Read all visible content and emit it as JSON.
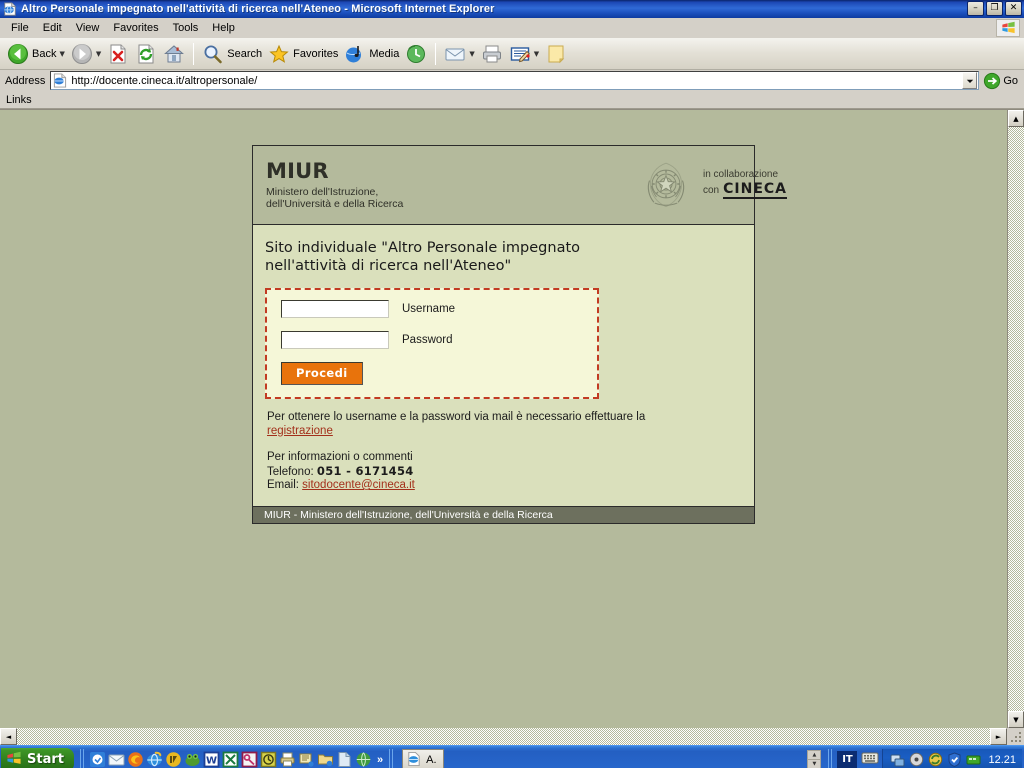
{
  "window": {
    "title": "Altro Personale impegnato nell'attività di ricerca nell'Ateneo - Microsoft Internet Explorer",
    "icon": "ie-document-icon",
    "minimize_label": "–",
    "restore_label": "❐",
    "close_label": "✕"
  },
  "menubar": {
    "items": [
      {
        "label": "File",
        "name": "menu-file"
      },
      {
        "label": "Edit",
        "name": "menu-edit"
      },
      {
        "label": "View",
        "name": "menu-view"
      },
      {
        "label": "Favorites",
        "name": "menu-favorites"
      },
      {
        "label": "Tools",
        "name": "menu-tools"
      },
      {
        "label": "Help",
        "name": "menu-help"
      }
    ],
    "brand_icon": "windows-flag-icon"
  },
  "toolbar": {
    "back_label": "Back",
    "forward_label": "",
    "stop_label": "",
    "refresh_label": "",
    "home_label": "",
    "search_label": "Search",
    "favorites_label": "Favorites",
    "media_label": "Media",
    "history_label": "",
    "mail_label": "",
    "print_label": "",
    "edit_label": "",
    "discuss_label": "",
    "icons": [
      "back-arrow-icon",
      "forward-arrow-icon",
      "stop-icon",
      "refresh-icon",
      "home-icon",
      "search-icon",
      "favorites-star-icon",
      "media-icon",
      "history-icon",
      "mail-icon",
      "print-icon",
      "edit-page-icon",
      "notes-icon"
    ]
  },
  "address_bar": {
    "label": "Address",
    "url": "http://docente.cineca.it/altropersonale/",
    "placeholder": "http://",
    "go_label": "Go",
    "site_icon": "ie-page-icon",
    "dropdown_icon": "chevron-down-icon",
    "go_icon": "go-arrow-icon"
  },
  "links_bar": {
    "label": "Links"
  },
  "page": {
    "header": {
      "acronym": "MIUR",
      "subtitle_line1": "Ministero dell'Istruzione,",
      "subtitle_line2": "dell'Università e della Ricerca",
      "emblem_name": "italian-republic-emblem",
      "collab_line1": "in collaborazione",
      "collab_con": "con",
      "collab_partner": "CINECA"
    },
    "site_title_line1": "Sito individuale \"Altro Personale impegnato",
    "site_title_line2": "nell'attività di ricerca nell'Ateneo\"",
    "login": {
      "username_label": "Username",
      "username_value": "",
      "username_placeholder": "",
      "password_label": "Password",
      "password_value": "",
      "password_placeholder": "",
      "submit_label": "Procedi"
    },
    "notes": {
      "register_text": "Per ottenere lo username e la password via mail è necessario effettuare la",
      "register_link": "registrazione",
      "info_heading": "Per informazioni o commenti",
      "phone_label": "Telefono:",
      "phone_value": "051 - 6171454",
      "email_label": "Email:",
      "email_value": "sitodocente@cineca.it"
    },
    "footer": "MIUR - Ministero dell'Istruzione, dell'Università e della Ricerca",
    "colors": {
      "page_background": "#b4ba9c",
      "content_background": "#dae0bc",
      "login_box_background": "#f5f7d8",
      "login_box_border": "#c23b22",
      "submit_button": "#e8730c",
      "footer_background": "#6d705e",
      "link": "#a3301b"
    }
  },
  "scrollbar": {
    "up_arrow": "▲",
    "down_arrow": "▼",
    "left_arrow": "◄",
    "right_arrow": "►"
  },
  "taskbar": {
    "start_label": "Start",
    "start_icon": "windows-flag-icon",
    "quicklaunch_icons": [
      "outlook-icon",
      "mail-icon",
      "firefox-icon",
      "internet-explorer-icon",
      "winamp-icon",
      "frog-icon",
      "word-icon",
      "excel-icon",
      "key-icon",
      "clock-icon",
      "printer-icon",
      "scanner-icon",
      "folder-image-icon",
      "document-icon",
      "globe-icon"
    ],
    "overflow_label": "»",
    "task_label": "A.",
    "task_icon": "internet-explorer-icon",
    "spinner_up": "▲",
    "spinner_down": "▼",
    "language": "IT",
    "keyboard_icon": "keyboard-icon",
    "tray_icons": [
      "network-icon",
      "sound-icon",
      "update-icon",
      "shield-icon",
      "lan-icon"
    ],
    "clock": "12.21"
  }
}
